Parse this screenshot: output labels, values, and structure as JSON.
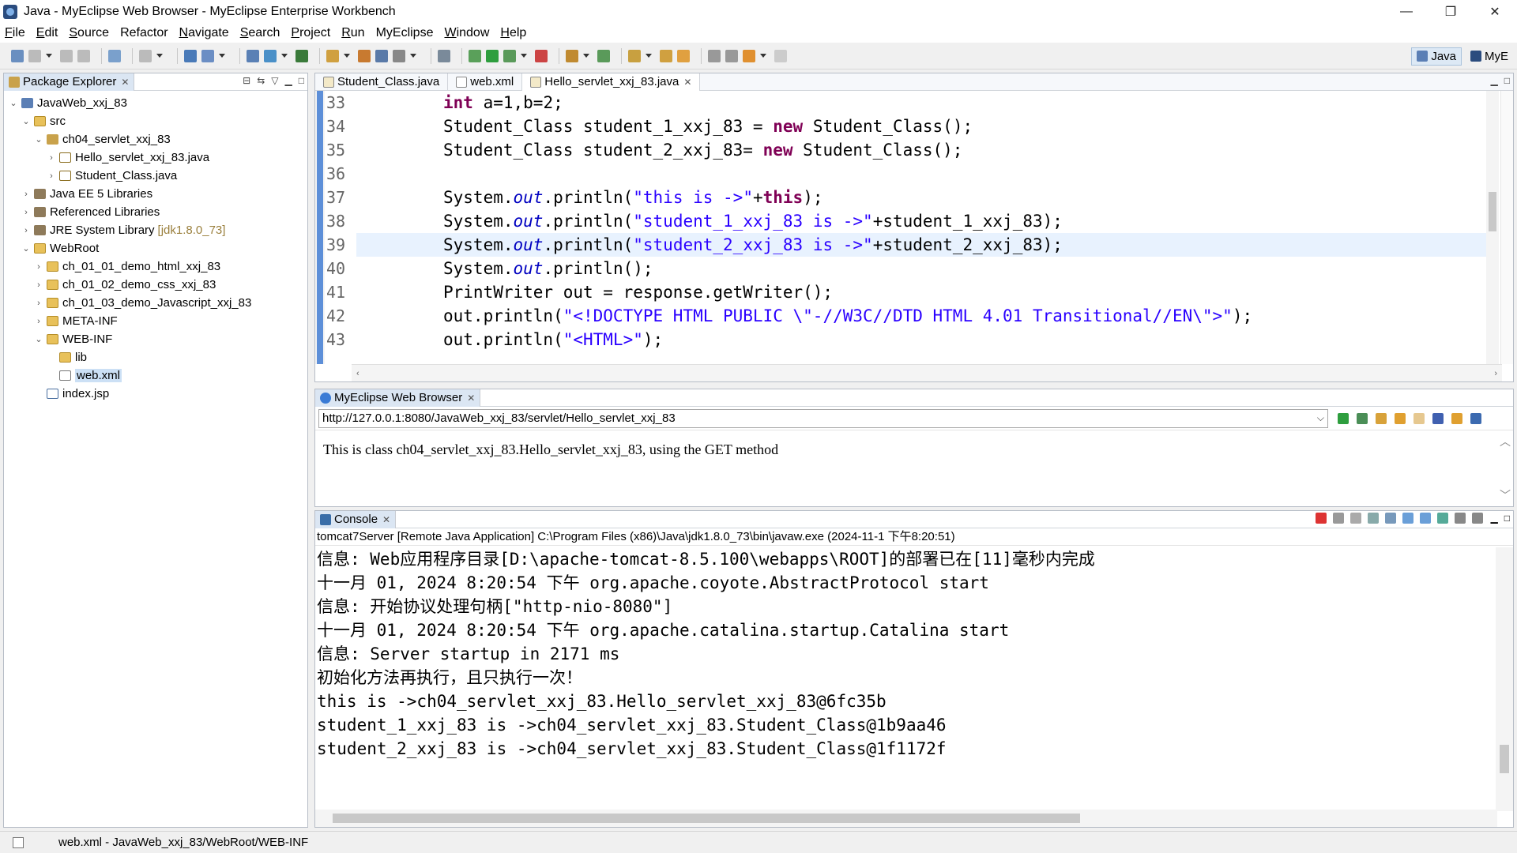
{
  "window": {
    "title": "Java - MyEclipse Web Browser - MyEclipse Enterprise Workbench",
    "minimize": "—",
    "restore": "❐",
    "close": "✕"
  },
  "menu": [
    {
      "label": "File",
      "u": "F",
      "rest": "ile"
    },
    {
      "label": "Edit",
      "u": "E",
      "rest": "dit"
    },
    {
      "label": "Source",
      "u": "S",
      "rest": "ource"
    },
    {
      "label": "Refactor",
      "u": "",
      "rest": "Refactor"
    },
    {
      "label": "Navigate",
      "u": "N",
      "rest": "avigate"
    },
    {
      "label": "Search",
      "u": "S",
      "rest": "earch"
    },
    {
      "label": "Project",
      "u": "P",
      "rest": "roject"
    },
    {
      "label": "Run",
      "u": "R",
      "rest": "un"
    },
    {
      "label": "MyEclipse",
      "u": "",
      "rest": "MyEclipse"
    },
    {
      "label": "Window",
      "u": "W",
      "rest": "indow"
    },
    {
      "label": "Help",
      "u": "H",
      "rest": "elp"
    }
  ],
  "perspectives": {
    "java": "Java",
    "myeclipse": "MyE"
  },
  "package_explorer": {
    "title": "Package Explorer",
    "tree": [
      {
        "label": "JavaWeb_xxj_83",
        "twisty": "v",
        "depth": 0,
        "icon": "proj"
      },
      {
        "label": "src",
        "twisty": "v",
        "depth": 1,
        "icon": "folder"
      },
      {
        "label": "ch04_servlet_xxj_83",
        "twisty": "v",
        "depth": 2,
        "icon": "pkg"
      },
      {
        "label": "Hello_servlet_xxj_83.java",
        "twisty": ">",
        "depth": 3,
        "icon": "java"
      },
      {
        "label": "Student_Class.java",
        "twisty": ">",
        "depth": 3,
        "icon": "java"
      },
      {
        "label": "Java EE 5 Libraries",
        "twisty": ">",
        "depth": 1,
        "icon": "lib"
      },
      {
        "label": "Referenced Libraries",
        "twisty": ">",
        "depth": 1,
        "icon": "lib"
      },
      {
        "label": "JRE System Library",
        "suffix": "[jdk1.8.0_73]",
        "twisty": ">",
        "depth": 1,
        "icon": "lib"
      },
      {
        "label": "WebRoot",
        "twisty": "v",
        "depth": 1,
        "icon": "folder"
      },
      {
        "label": "ch_01_01_demo_html_xxj_83",
        "twisty": ">",
        "depth": 2,
        "icon": "folder"
      },
      {
        "label": "ch_01_02_demo_css_xxj_83",
        "twisty": ">",
        "depth": 2,
        "icon": "folder"
      },
      {
        "label": "ch_01_03_demo_Javascript_xxj_83",
        "twisty": ">",
        "depth": 2,
        "icon": "folder"
      },
      {
        "label": "META-INF",
        "twisty": ">",
        "depth": 2,
        "icon": "folder"
      },
      {
        "label": "WEB-INF",
        "twisty": "v",
        "depth": 2,
        "icon": "folder"
      },
      {
        "label": "lib",
        "twisty": "",
        "depth": 3,
        "icon": "folder"
      },
      {
        "label": "web.xml",
        "twisty": "",
        "depth": 3,
        "icon": "xml",
        "selected": true
      },
      {
        "label": "index.jsp",
        "twisty": "",
        "depth": 2,
        "icon": "jsp"
      }
    ]
  },
  "editor": {
    "tabs": [
      "Student_Class.java",
      "web.xml",
      "Hello_servlet_xxj_83.java"
    ],
    "active_tab": 2,
    "lines": [
      {
        "n": "33",
        "tokens": [
          [
            "kw",
            "int"
          ],
          [
            "",
            " a=1,b=2;"
          ]
        ]
      },
      {
        "n": "34",
        "tokens": [
          [
            "",
            "Student_Class student_1_xxj_83 = "
          ],
          [
            "kw",
            "new"
          ],
          [
            "",
            " Student_Class();"
          ]
        ]
      },
      {
        "n": "35",
        "tokens": [
          [
            "",
            "Student_Class student_2_xxj_83= "
          ],
          [
            "kw",
            "new"
          ],
          [
            "",
            " Student_Class();"
          ]
        ]
      },
      {
        "n": "36",
        "tokens": [
          [
            "",
            ""
          ]
        ]
      },
      {
        "n": "37",
        "tokens": [
          [
            "",
            "System."
          ],
          [
            "fld",
            "out"
          ],
          [
            "",
            ".println("
          ],
          [
            "str",
            "\"this is ->\""
          ],
          [
            "",
            "+"
          ],
          [
            "kw",
            "this"
          ],
          [
            "",
            ");"
          ]
        ]
      },
      {
        "n": "38",
        "tokens": [
          [
            "",
            "System."
          ],
          [
            "fld",
            "out"
          ],
          [
            "",
            ".println("
          ],
          [
            "str",
            "\"student_1_xxj_83 is ->\""
          ],
          [
            "",
            "+student_1_xxj_83);"
          ]
        ]
      },
      {
        "n": "39",
        "tokens": [
          [
            "",
            "System."
          ],
          [
            "fld",
            "out"
          ],
          [
            "",
            ".println("
          ],
          [
            "str",
            "\"student_2_xxj_83 is ->\""
          ],
          [
            "",
            "+student_2_xxj_83);"
          ]
        ],
        "highlight": true
      },
      {
        "n": "40",
        "tokens": [
          [
            "",
            "System."
          ],
          [
            "fld",
            "out"
          ],
          [
            "",
            ".println();"
          ]
        ]
      },
      {
        "n": "41",
        "tokens": [
          [
            "",
            "PrintWriter out = response.getWriter();"
          ]
        ]
      },
      {
        "n": "42",
        "tokens": [
          [
            "",
            "out.println("
          ],
          [
            "str",
            "\"<!DOCTYPE HTML PUBLIC \\\"-//W3C//DTD HTML 4.01 Transitional//EN\\\">\""
          ],
          [
            "",
            ");"
          ]
        ]
      },
      {
        "n": "43",
        "tokens": [
          [
            "",
            "out.println("
          ],
          [
            "str",
            "\"<HTML>\""
          ],
          [
            "",
            ");"
          ]
        ]
      }
    ]
  },
  "browser": {
    "title": "MyEclipse Web Browser",
    "url": "http://127.0.0.1:8080/JavaWeb_xxj_83/servlet/Hello_servlet_xxj_83",
    "page_text": "This is class ch04_servlet_xxj_83.Hello_servlet_xxj_83, using the GET method"
  },
  "console": {
    "title": "Console",
    "description": "tomcat7Server [Remote Java Application] C:\\Program Files (x86)\\Java\\jdk1.8.0_73\\bin\\javaw.exe (2024-11-1 下午8:20:51)",
    "lines": [
      "信息: Web应用程序目录[D:\\apache-tomcat-8.5.100\\webapps\\ROOT]的部署已在[11]毫秒内完成",
      "十一月 01, 2024 8:20:54 下午 org.apache.coyote.AbstractProtocol start",
      "信息: 开始协议处理句柄[\"http-nio-8080\"]",
      "十一月 01, 2024 8:20:54 下午 org.apache.catalina.startup.Catalina start",
      "信息: Server startup in 2171 ms",
      "初始化方法再执行，且只执行一次！",
      "this is ->ch04_servlet_xxj_83.Hello_servlet_xxj_83@6fc35b",
      "student_1_xxj_83 is ->ch04_servlet_xxj_83.Student_Class@1b9aa46",
      "student_2_xxj_83 is ->ch04_servlet_xxj_83.Student_Class@1f1172f"
    ]
  },
  "status": {
    "text": "web.xml - JavaWeb_xxj_83/WebRoot/WEB-INF"
  },
  "colors": {
    "keyword": "#7f0055",
    "string": "#2a00ff",
    "field": "#0000c0",
    "highlight_line": "#e8f2fe",
    "selection": "#cce0f5"
  }
}
